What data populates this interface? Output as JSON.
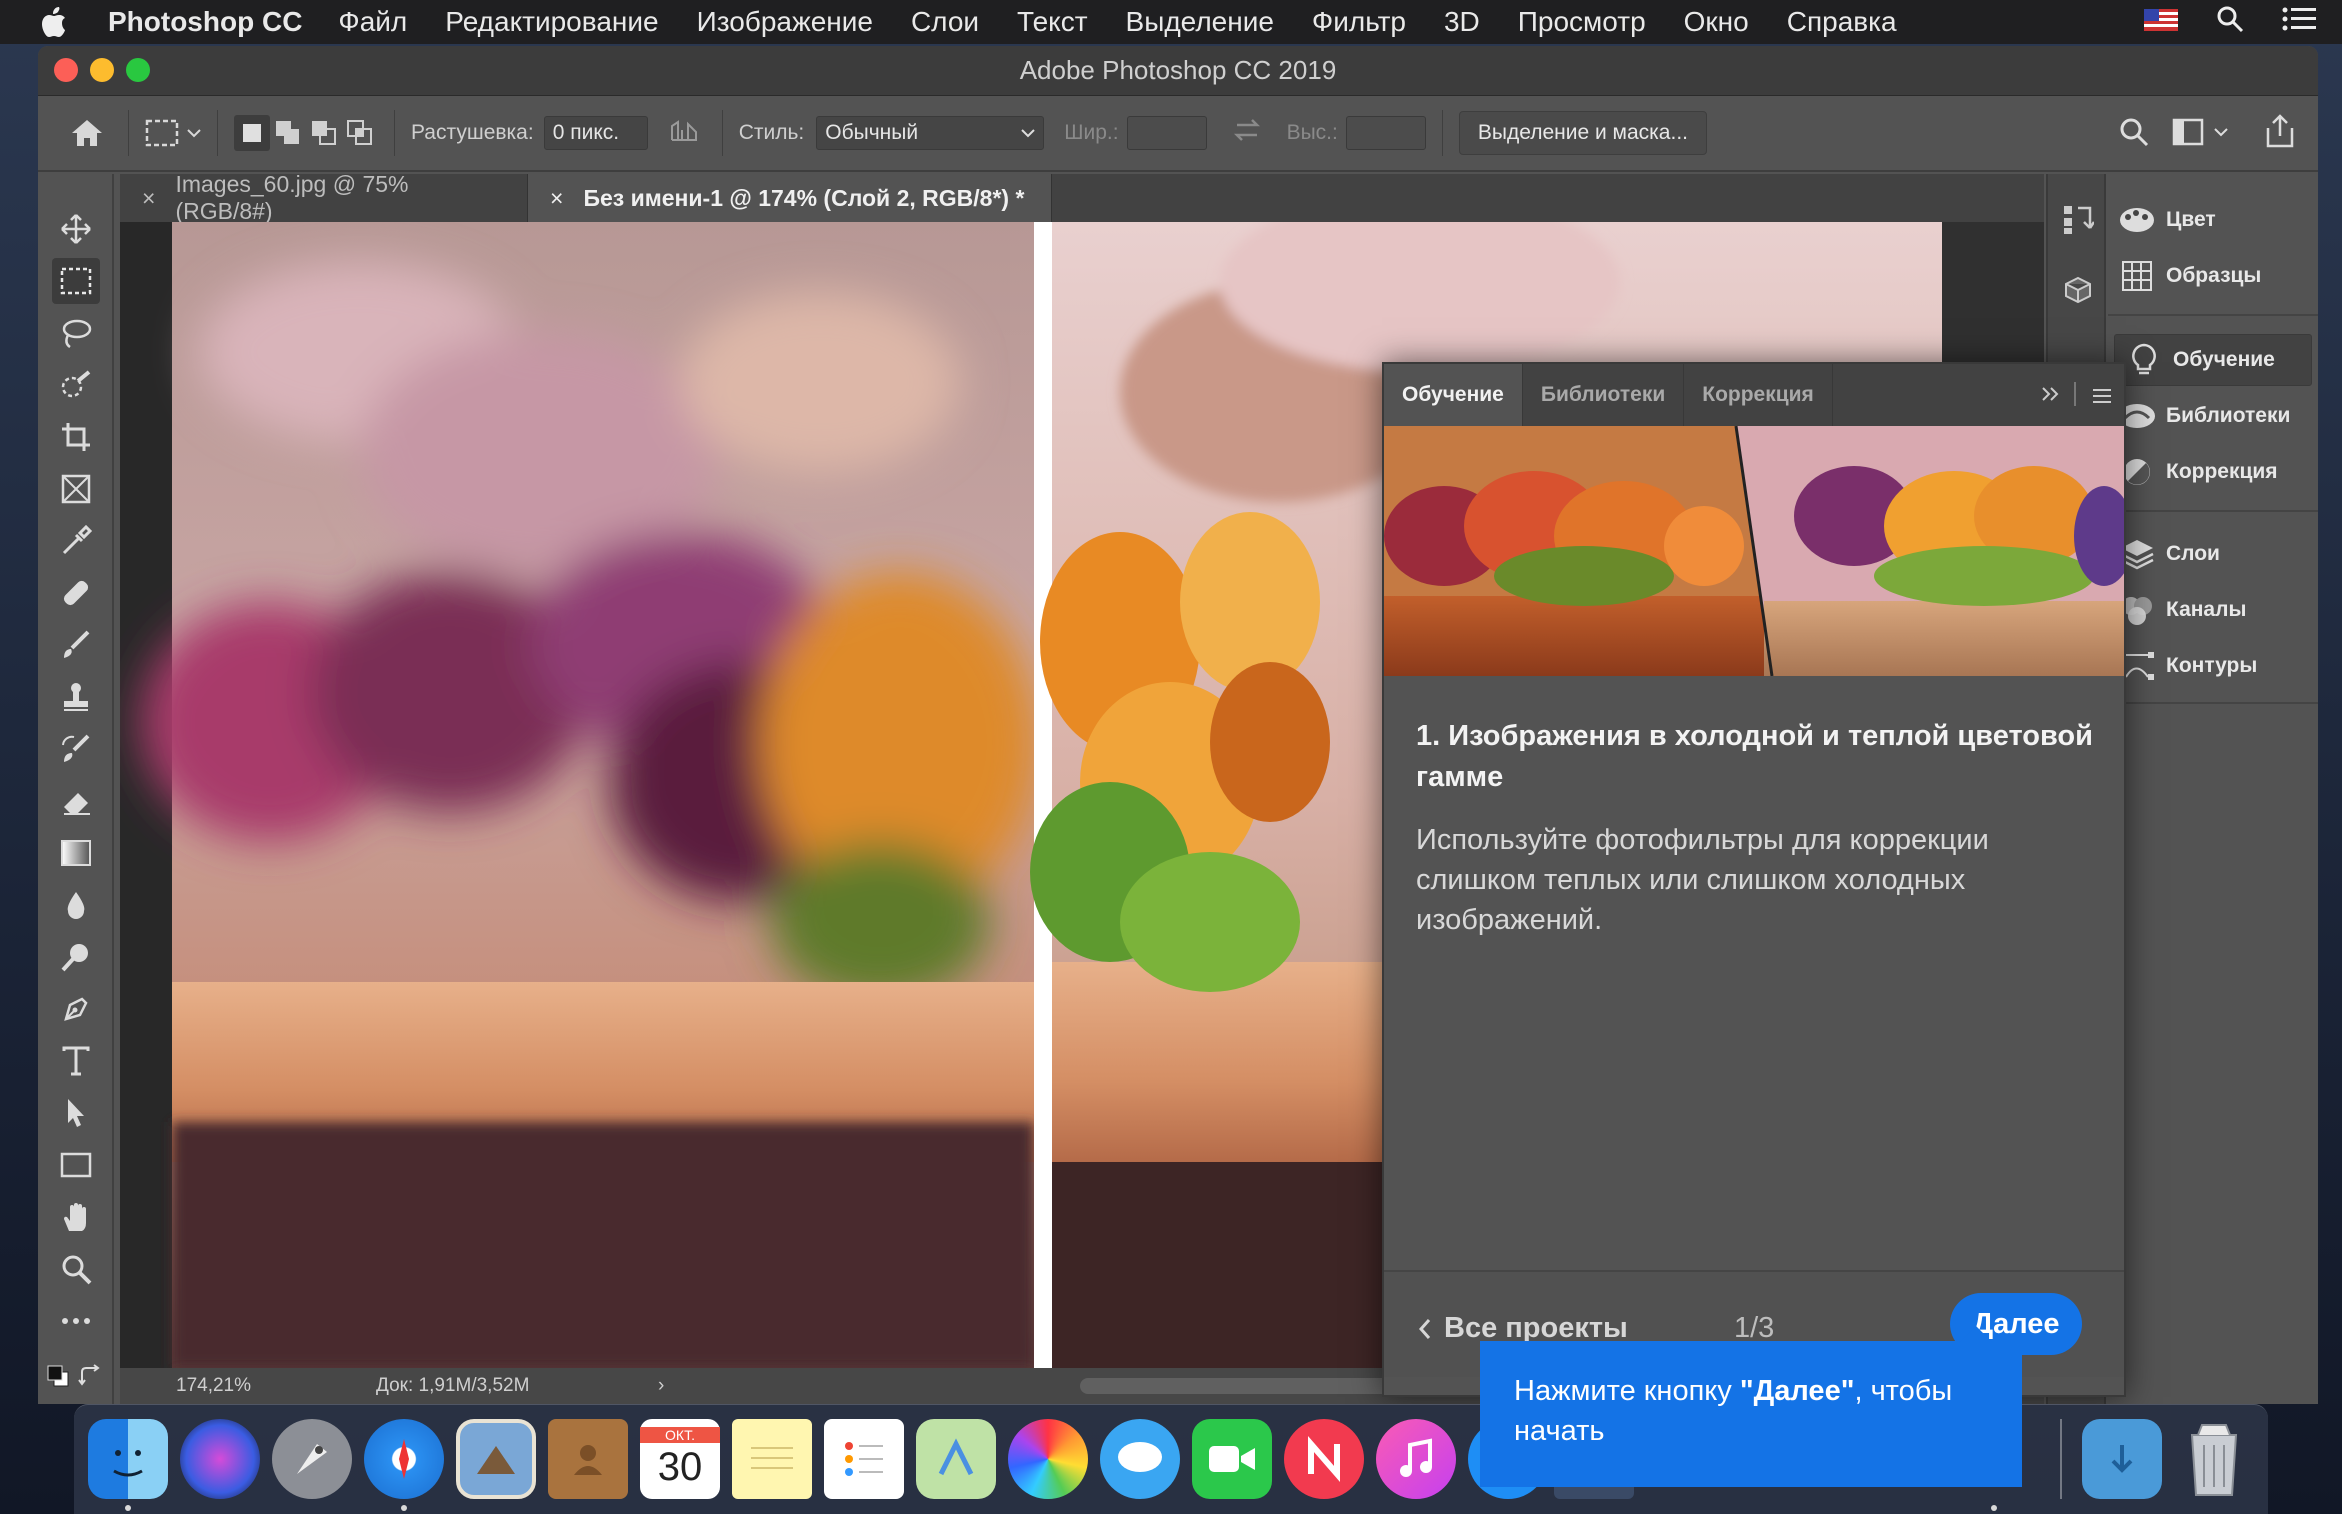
{
  "menubar": {
    "app_name": "Photoshop CC",
    "items": [
      "Файл",
      "Редактирование",
      "Изображение",
      "Слои",
      "Текст",
      "Выделение",
      "Фильтр",
      "3D",
      "Просмотр",
      "Окно",
      "Справка"
    ]
  },
  "window": {
    "title": "Adobe Photoshop CC 2019"
  },
  "options": {
    "feather_label": "Растушевка:",
    "feather_value": "0 пикс.",
    "style_label": "Стиль:",
    "style_value": "Обычный",
    "width_label": "Шир.:",
    "height_label": "Выс.:",
    "select_mask_button": "Выделение и маска..."
  },
  "tabs": [
    {
      "label": "Images_60.jpg @ 75% (RGB/8#)",
      "close": "×"
    },
    {
      "label": "Без имени-1 @ 174% (Слой 2, RGB/8*) *",
      "close": "×"
    }
  ],
  "status": {
    "zoom": "174,21%",
    "doc": "Док: 1,91M/3,52M",
    "arrow": "›"
  },
  "right_panel": {
    "items": [
      {
        "label": "Цвет",
        "icon": "color-icon"
      },
      {
        "label": "Образцы",
        "icon": "swatches-icon"
      },
      {
        "label": "Обучение",
        "icon": "learn-icon"
      },
      {
        "label": "Библиотеки",
        "icon": "libraries-icon"
      },
      {
        "label": "Коррекция",
        "icon": "adjustments-icon"
      },
      {
        "label": "Слои",
        "icon": "layers-icon"
      },
      {
        "label": "Каналы",
        "icon": "channels-icon"
      },
      {
        "label": "Контуры",
        "icon": "paths-icon"
      }
    ]
  },
  "learn": {
    "tabs": [
      "Обучение",
      "Библиотеки",
      "Коррекция"
    ],
    "title": "1.  Изображения в холодной и теплой цветовой гамме",
    "body": "Используйте фотофильтры для коррекции слишком теплых или слишком холодных изображений.",
    "back": "Все проекты",
    "page": "1/3",
    "next": "Далее"
  },
  "tooltip": {
    "before": "Нажмите кнопку ",
    "bold": "\"Далее\"",
    "after": ", чтобы начать"
  },
  "dock": {
    "calendar_month": "ОКТ.",
    "calendar_day": "30"
  },
  "colors": {
    "accent": "#1473e6",
    "panel": "#535353",
    "panel_dark": "#424242"
  }
}
